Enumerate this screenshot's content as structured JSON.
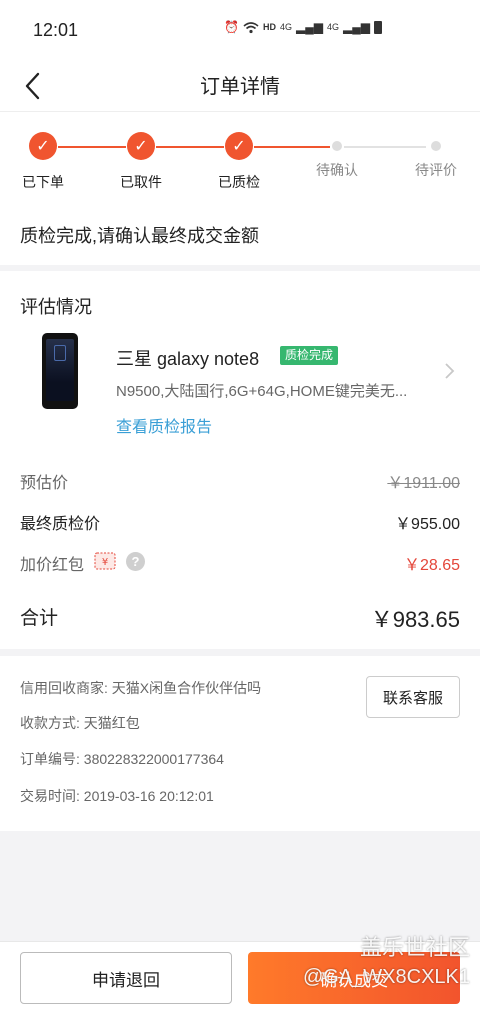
{
  "status_bar": {
    "time": "12:01",
    "icons": [
      "alarm-icon",
      "wifi-icon",
      "HD",
      "4G",
      "4G",
      "battery-icon"
    ],
    "hd": "HD",
    "net1": "4G",
    "net2": "4G"
  },
  "nav": {
    "title": "订单详情"
  },
  "progress": {
    "steps": [
      {
        "label": "已下单",
        "done": true
      },
      {
        "label": "已取件",
        "done": true
      },
      {
        "label": "已质检",
        "done": true
      },
      {
        "label": "待确认",
        "done": false
      },
      {
        "label": "待评价",
        "done": false
      }
    ],
    "message": "质检完成,请确认最终成交金额"
  },
  "evaluation": {
    "title": "评估情况",
    "product": {
      "name": "三星 galaxy note8",
      "badge": "质检完成",
      "specs": "N9500,大陆国行,6G+64G,HOME键完美无...",
      "report_link": "查看质检报告"
    },
    "rows": {
      "estimate_label": "预估价",
      "estimate_value": "￥1911.00",
      "final_label": "最终质检价",
      "final_value": "￥955.00",
      "bonus_label": "加价红包",
      "bonus_icon": "¥",
      "bonus_value": "￥28.65"
    },
    "total_label": "合计",
    "total_value": "￥983.65"
  },
  "info": {
    "merchant": "信用回收商家: 天猫X闲鱼合作伙伴估吗",
    "payment": "收款方式: 天猫红包",
    "order_no": "订单编号: 380228322000177364",
    "time": "交易时间: 2019-03-16 20:12:01",
    "contact_button": "联系客服"
  },
  "bottom": {
    "refund_button": "申请退回",
    "confirm_button": "确认成交"
  },
  "watermark": {
    "top": "盖乐世社区",
    "bottom": "@GA_WX8CXLK1"
  },
  "colors": {
    "accent": "#f0552f",
    "badge_green": "#36b76f",
    "link_blue": "#3a9fd6",
    "price_red": "#e4463a"
  }
}
